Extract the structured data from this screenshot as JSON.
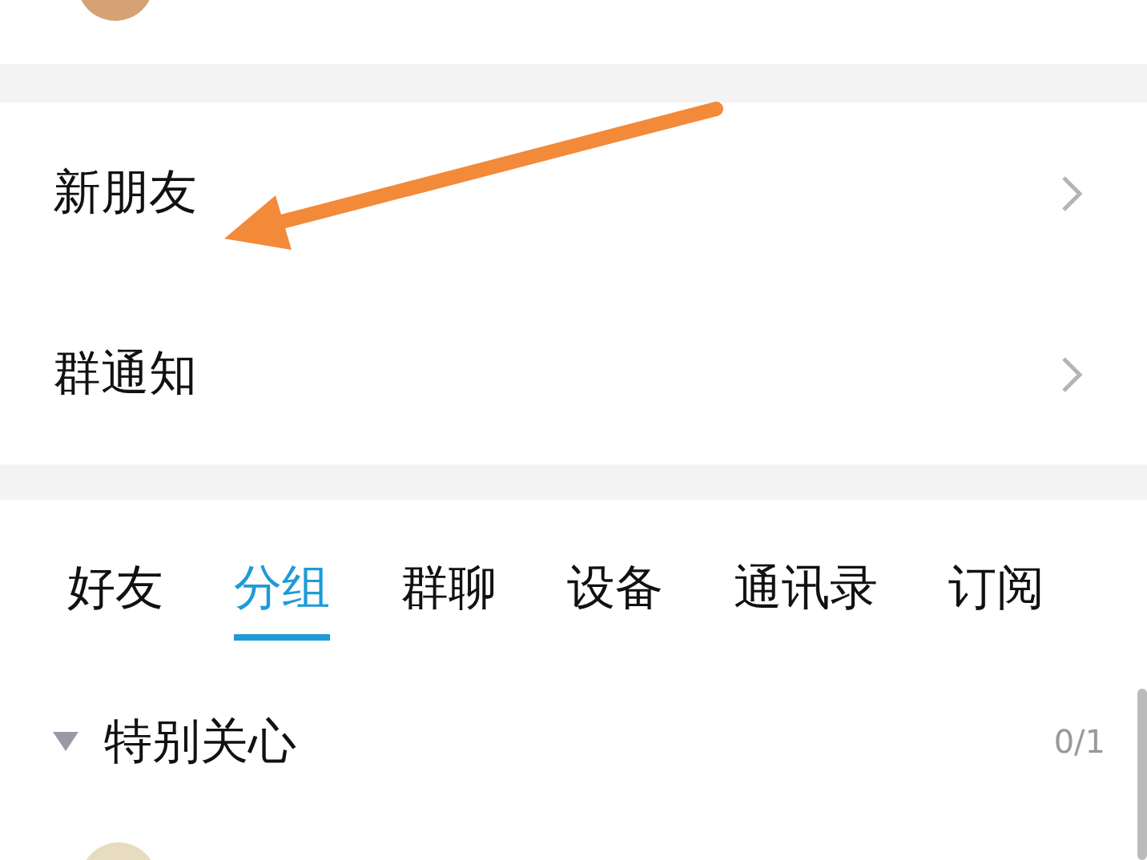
{
  "entries": [
    {
      "label": "新朋友"
    },
    {
      "label": "群通知"
    }
  ],
  "tabs": [
    {
      "label": "好友",
      "selected": false
    },
    {
      "label": "分组",
      "selected": true
    },
    {
      "label": "群聊",
      "selected": false
    },
    {
      "label": "设备",
      "selected": false
    },
    {
      "label": "通讯录",
      "selected": false
    },
    {
      "label": "订阅",
      "selected": false
    }
  ],
  "groups": [
    {
      "name": "特别关心",
      "count": "0/1",
      "expanded": true
    }
  ]
}
